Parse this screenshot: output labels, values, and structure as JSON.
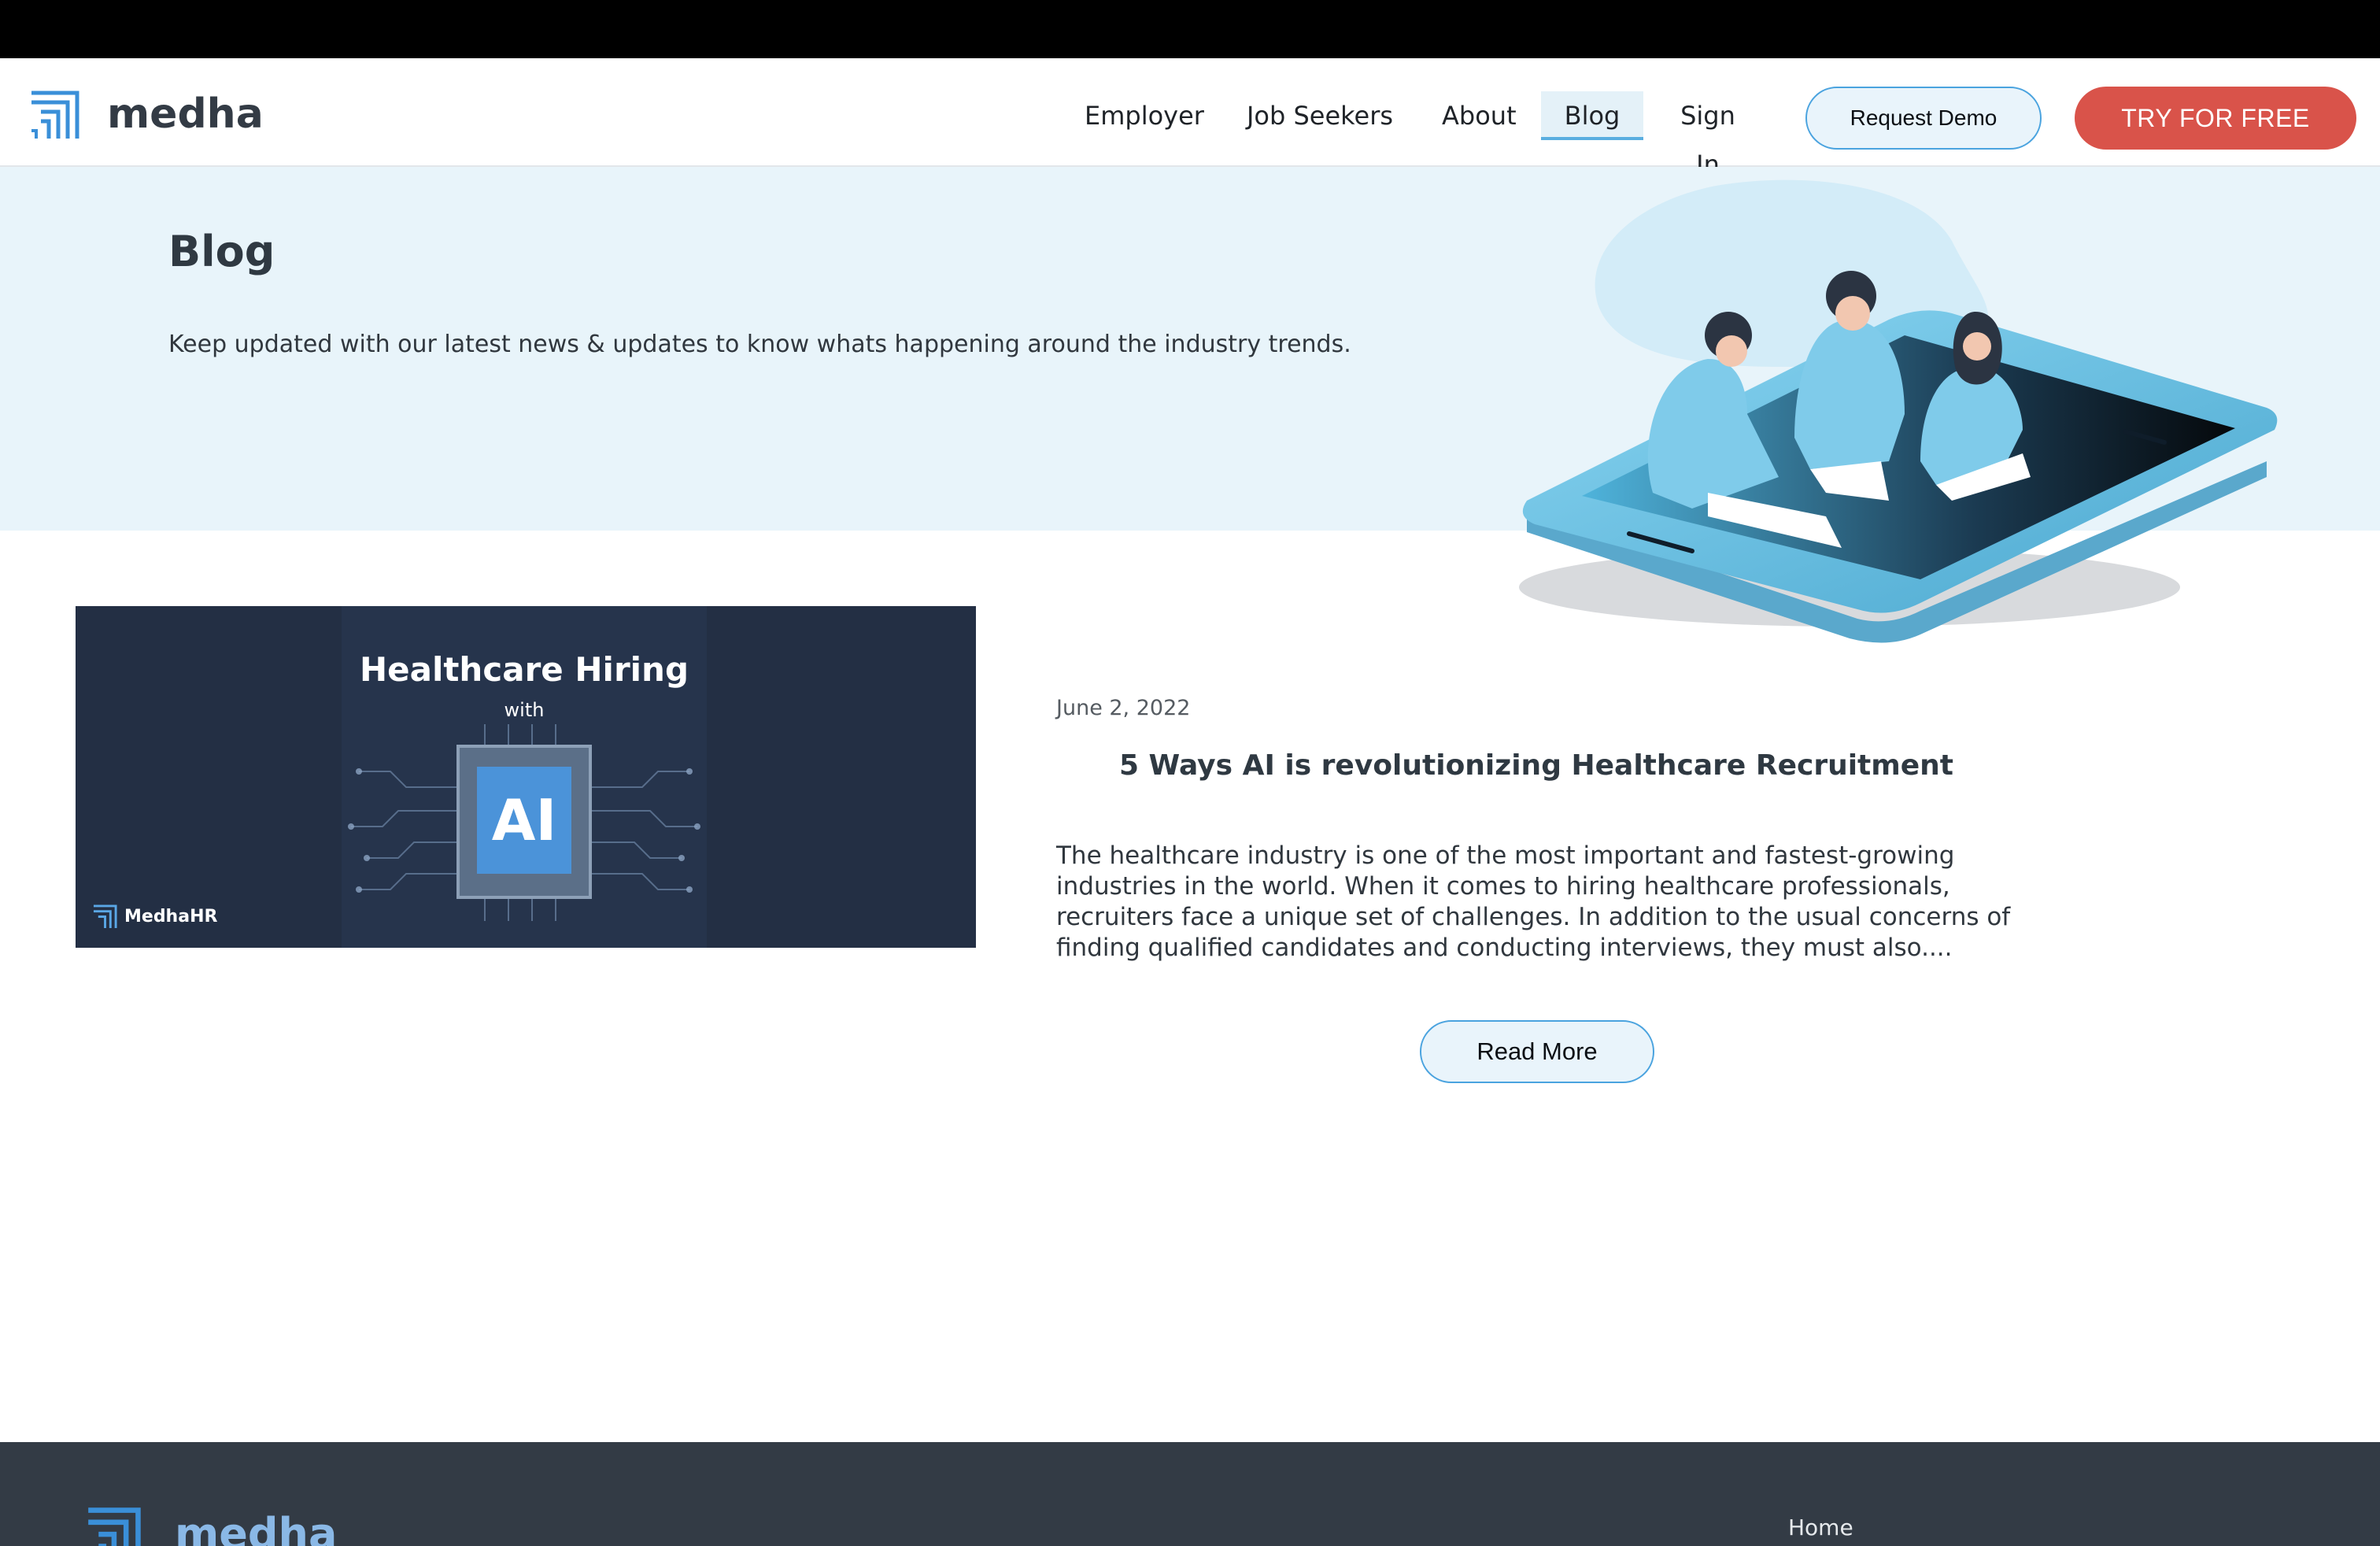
{
  "brand": {
    "name": "medha",
    "accent": "#3a8fd8"
  },
  "nav": {
    "links": [
      {
        "label": "Employer"
      },
      {
        "label": "Job Seekers"
      },
      {
        "label": "About"
      },
      {
        "label": "Blog",
        "active": true
      },
      {
        "label": "Sign In"
      }
    ],
    "request_demo": "Request Demo",
    "try_free": "TRY FOR FREE"
  },
  "hero": {
    "title": "Blog",
    "subtitle": "Keep updated with our latest news & updates to know whats happening around the industry trends."
  },
  "post": {
    "image": {
      "title": "Healthcare Hiring",
      "with": "with",
      "chip_text": "AI",
      "brand": "MedhaHR"
    },
    "date": "June 2, 2022",
    "title": "5 Ways AI is revolutionizing Healthcare Recruitment",
    "excerpt": "The healthcare industry is one of the most important and fastest-growing industries in the world. When it comes to hiring healthcare professionals, recruiters face a unique set of challenges. In addition to the usual concerns of finding qualified candidates and conducting interviews, they must also....",
    "read_more": "Read More"
  },
  "footer": {
    "brand": "medha",
    "home": "Home"
  },
  "colors": {
    "hero_bg": "#e8f4fa",
    "try_button": "#d9534a",
    "footer_bg": "#333b45",
    "active_underline": "#5aaee0"
  }
}
